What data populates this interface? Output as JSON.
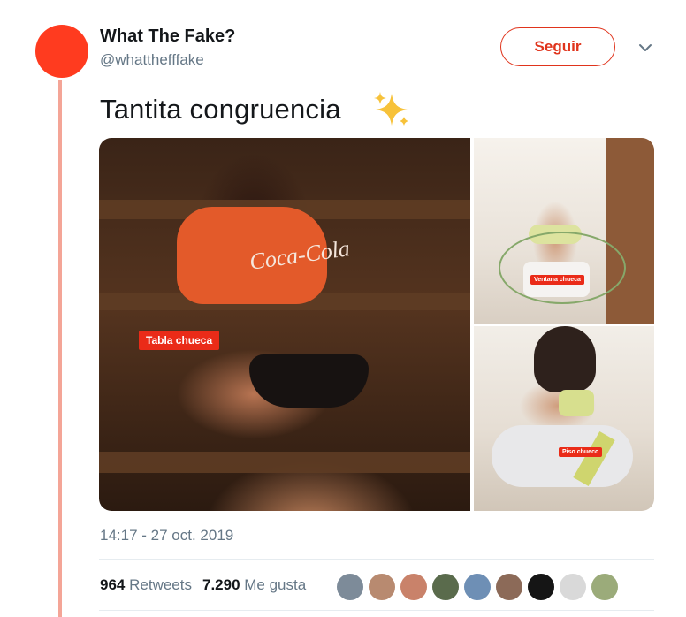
{
  "author": {
    "name": "What The Fake?",
    "handle": "@whatthefffake",
    "avatar_color": "#ff3b1f"
  },
  "follow_button": {
    "label": "Seguir",
    "color": "#e0341c"
  },
  "menu_icon": "chevron-down-icon",
  "tweet": {
    "text": "Tantita congruencia",
    "emoji_icon": "sparkles-icon",
    "timestamp": "14:17 - 27 oct. 2019"
  },
  "media": {
    "photos": [
      {
        "label": "Tabla chueca",
        "logo_text": "Coca-Cola"
      },
      {
        "label": "Ventana chueca"
      },
      {
        "label": "Piso chueco"
      }
    ]
  },
  "stats": {
    "retweets_count": "964",
    "retweets_label": "Retweets",
    "likes_count": "7.290",
    "likes_label": "Me gusta"
  },
  "likers": [
    {
      "color": "#7d8b99"
    },
    {
      "color": "#b88a70"
    },
    {
      "color": "#c9826a"
    },
    {
      "color": "#5a6b4c"
    },
    {
      "color": "#6e8fb5"
    },
    {
      "color": "#8c6a58"
    },
    {
      "color": "#151515"
    },
    {
      "color": "#d9d9d9"
    },
    {
      "color": "#9bab7a"
    }
  ],
  "colors": {
    "accent": "#e0341c",
    "thread_line": "#f4a597",
    "secondary_text": "#657786"
  }
}
